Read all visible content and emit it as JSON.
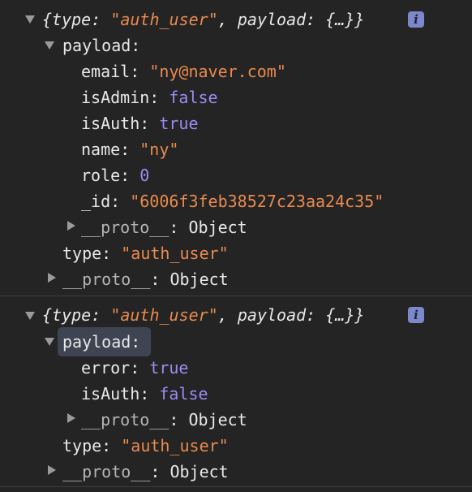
{
  "colors": {
    "background": "#242424",
    "key": "#e8e8e8",
    "string": "#e98a4e",
    "keyword": "#9b8cf2",
    "badge": "#7c88c9",
    "highlight": "#3e4451"
  },
  "info_icon": {
    "glyph": "i",
    "icon": "info-icon"
  },
  "entries": [
    {
      "summary": {
        "open": "{",
        "type_key": "type",
        "colon": ": ",
        "type_value": "\"auth_user\"",
        "sep": ", ",
        "payload_key": "payload",
        "payload_value": "{…}",
        "close": "}"
      },
      "payload_label": "payload",
      "payload_fields": [
        {
          "key": "email",
          "value": "\"ny@naver.com\"",
          "kind": "string"
        },
        {
          "key": "isAdmin",
          "value": "false",
          "kind": "keyword"
        },
        {
          "key": "isAuth",
          "value": "true",
          "kind": "keyword"
        },
        {
          "key": "name",
          "value": "\"ny\"",
          "kind": "string"
        },
        {
          "key": "role",
          "value": "0",
          "kind": "keyword"
        },
        {
          "key": "_id",
          "value": "\"6006f3feb38527c23aa24c35\"",
          "kind": "string"
        }
      ],
      "payload_proto": {
        "key": "__proto__",
        "value": "Object"
      },
      "type_field": {
        "key": "type",
        "value": "\"auth_user\""
      },
      "proto": {
        "key": "__proto__",
        "value": "Object"
      }
    },
    {
      "summary": {
        "open": "{",
        "type_key": "type",
        "colon": ": ",
        "type_value": "\"auth_user\"",
        "sep": ", ",
        "payload_key": "payload",
        "payload_value": "{…}",
        "close": "}"
      },
      "payload_label": "payload",
      "payload_fields": [
        {
          "key": "error",
          "value": "true",
          "kind": "keyword"
        },
        {
          "key": "isAuth",
          "value": "false",
          "kind": "keyword"
        }
      ],
      "payload_proto": {
        "key": "__proto__",
        "value": "Object"
      },
      "type_field": {
        "key": "type",
        "value": "\"auth_user\""
      },
      "proto": {
        "key": "__proto__",
        "value": "Object"
      }
    }
  ]
}
